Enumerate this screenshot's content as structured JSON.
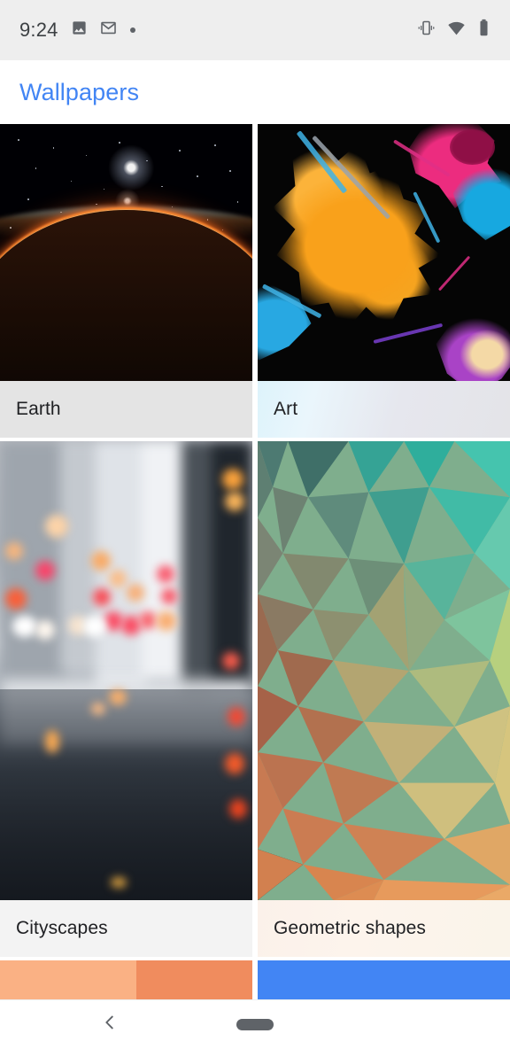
{
  "status_bar": {
    "time": "9:24",
    "left_icons": [
      "photo-icon",
      "gmail-icon",
      "dot-icon"
    ],
    "right_icons": [
      "vibrate-icon",
      "wifi-icon",
      "battery-icon"
    ],
    "background": "#eeeeee"
  },
  "app_bar": {
    "title": "Wallpapers",
    "title_color": "#4285f4"
  },
  "grid": {
    "columns": 2,
    "cards": [
      {
        "label": "Earth",
        "artwork": "earth-from-space-photo",
        "label_background": "#e4e4e4"
      },
      {
        "label": "Art",
        "artwork": "paint-splatter-artwork",
        "label_background": "#e7e7ea"
      },
      {
        "label": "Cityscapes",
        "artwork": "blurred-city-bokeh-photo",
        "label_background": "#f3f3f3"
      },
      {
        "label": "Geometric shapes",
        "artwork": "low-poly-triangle-gradient",
        "label_background": "#faf1ea"
      }
    ],
    "partial_next_row": [
      {
        "artwork": "orange-gradient-swatch",
        "colors": [
          "#fab184",
          "#f08c5e"
        ]
      },
      {
        "artwork": "blue-solid-swatch",
        "colors": [
          "#4285f4"
        ]
      }
    ]
  },
  "nav_bar": {
    "back_icon": "chevron-left-icon",
    "home_indicator": "home-pill-icon",
    "color": "#5f6368"
  }
}
